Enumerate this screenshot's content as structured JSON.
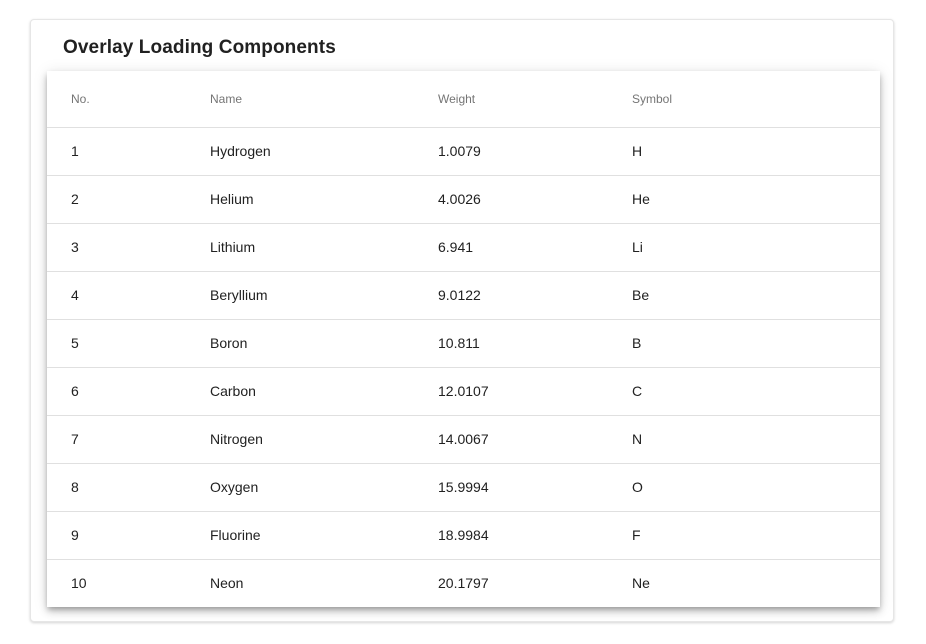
{
  "card": {
    "title": "Overlay Loading Components"
  },
  "table": {
    "headers": {
      "no": "No.",
      "name": "Name",
      "weight": "Weight",
      "symbol": "Symbol"
    },
    "rows": [
      {
        "no": "1",
        "name": "Hydrogen",
        "weight": "1.0079",
        "symbol": "H"
      },
      {
        "no": "2",
        "name": "Helium",
        "weight": "4.0026",
        "symbol": "He"
      },
      {
        "no": "3",
        "name": "Lithium",
        "weight": "6.941",
        "symbol": "Li"
      },
      {
        "no": "4",
        "name": "Beryllium",
        "weight": "9.0122",
        "symbol": "Be"
      },
      {
        "no": "5",
        "name": "Boron",
        "weight": "10.811",
        "symbol": "B"
      },
      {
        "no": "6",
        "name": "Carbon",
        "weight": "12.0107",
        "symbol": "C"
      },
      {
        "no": "7",
        "name": "Nitrogen",
        "weight": "14.0067",
        "symbol": "N"
      },
      {
        "no": "8",
        "name": "Oxygen",
        "weight": "15.9994",
        "symbol": "O"
      },
      {
        "no": "9",
        "name": "Fluorine",
        "weight": "18.9984",
        "symbol": "F"
      },
      {
        "no": "10",
        "name": "Neon",
        "weight": "20.1797",
        "symbol": "Ne"
      }
    ]
  }
}
